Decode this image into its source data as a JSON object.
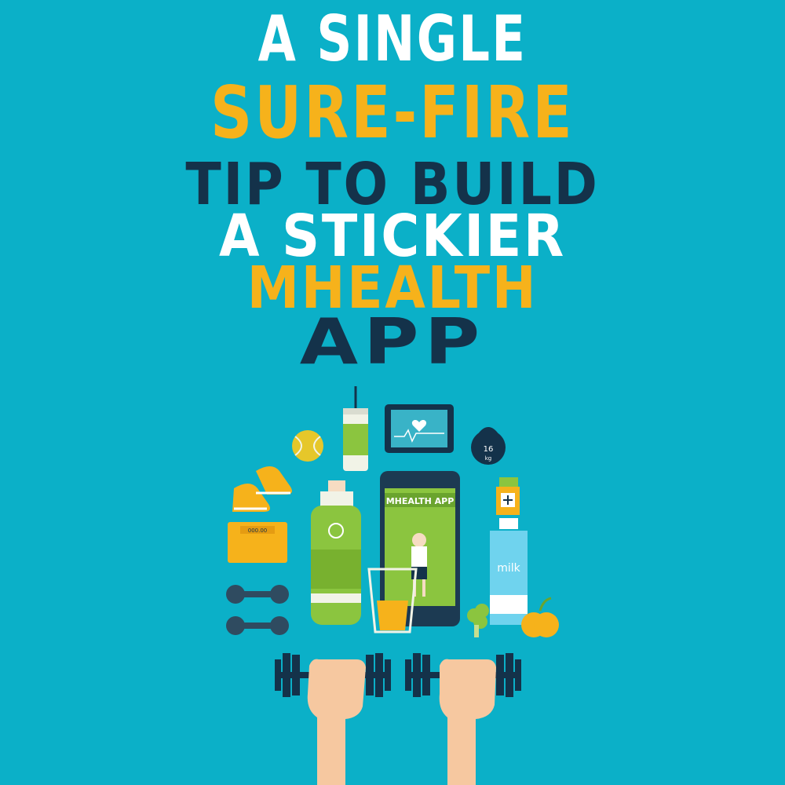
{
  "title": {
    "line1": "A SINGLE",
    "line2": "SURE-FIRE",
    "line3": "TIP TO BUILD",
    "line4": "A STICKIER",
    "line5": "MHEALTH",
    "line6": "APP"
  },
  "phone_screen_label": "MHEALTH APP",
  "kettlebell_label": "16",
  "kettlebell_unit": "kg",
  "scale_readout": "000.00",
  "milk_label": "milk",
  "colors": {
    "background": "#0bb0c8",
    "accent_yellow": "#f6b21b",
    "navy": "#14324a",
    "white": "#ffffff",
    "green": "#8bc53f"
  }
}
